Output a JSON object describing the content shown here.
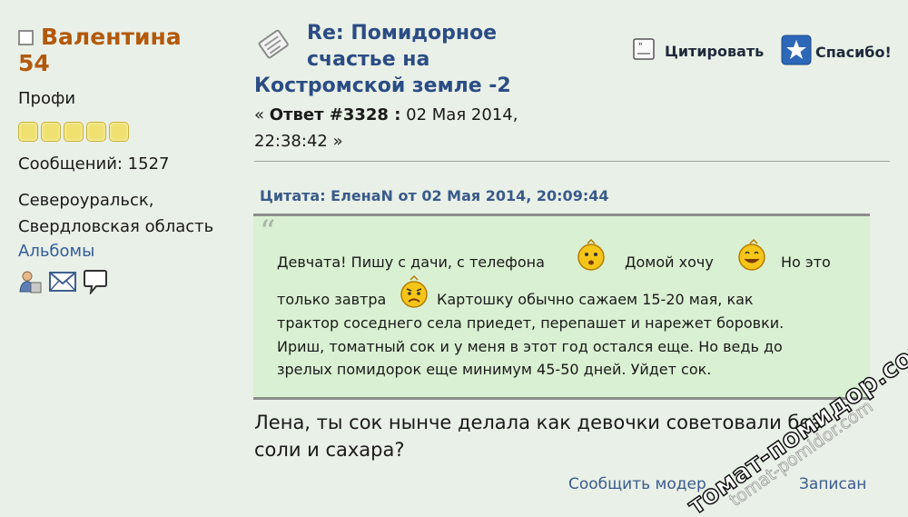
{
  "poster": {
    "name_line1": "Валентина",
    "name_line2": "54",
    "rank": "Профи",
    "stars_count": 5,
    "posts": "Сообщений: 1527",
    "location_line1": "Североуральск,",
    "location_line2": "Свердловская область",
    "albums": "Альбомы",
    "icons": [
      "profile-icon",
      "email-icon",
      "pm-icon"
    ]
  },
  "post": {
    "title_line1": "Re: Помидорное",
    "title_line2": "счастье на",
    "title_line3": "Костромской земле -2",
    "reply_open": "« ",
    "reply_label": "Ответ #3328 :",
    "reply_date_line1": " 02 Мая 2014,",
    "reply_date_line2": "22:38:42 »",
    "quote_button": "Цитировать",
    "thanks_button": "Спасибо!"
  },
  "quote": {
    "header": "Цитата: ЕленаN от 02 Мая 2014, 20:09:44",
    "mark": "“",
    "line1_a": "Девчата! Пишу с дачи, с телефона",
    "line1_b": "Домой хочу",
    "line1_c": "Но это",
    "line2_a": "только завтра",
    "line2_b": "Картошку обычно сажаем 15-20 мая, как",
    "line3": "трактор соседнего села приедет, перепашет и нарежет боровки.",
    "line4": "Ириш, томатный сок и у меня в этот год остался еще. Но ведь до",
    "line5": "зрелых помидорок еще минимум 45-50 дней. Уйдет сок."
  },
  "answer": {
    "line1": "Лена, ты сок нынче делала как девочки советовали без",
    "line2": "соли и сахара?"
  },
  "footer": {
    "report": "Сообщить модер",
    "logged": "Записан"
  },
  "watermark": {
    "text_main": "томат-помидор.com",
    "text_shadow": "tomat-pomidor.com"
  }
}
